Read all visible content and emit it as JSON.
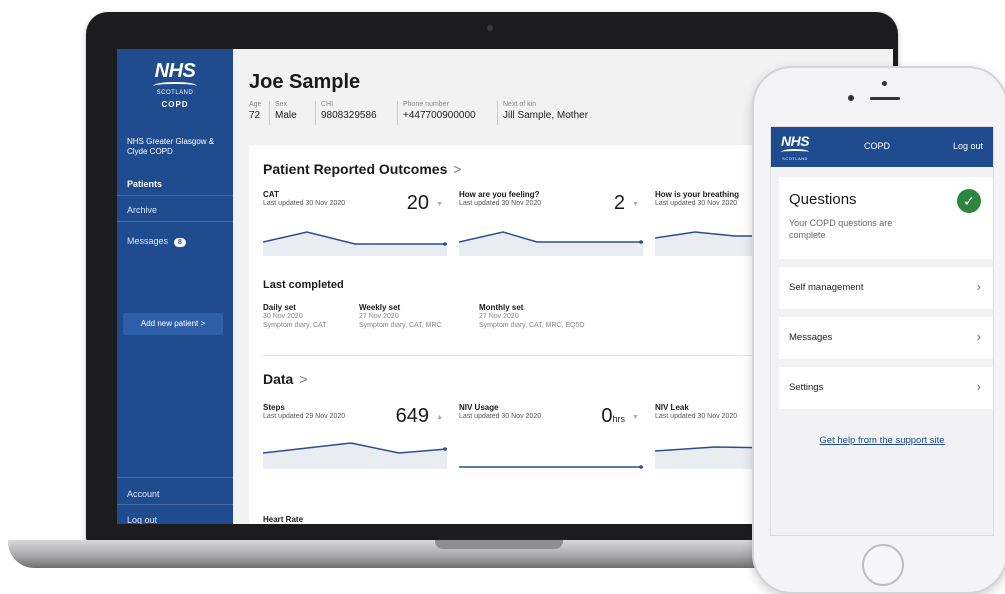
{
  "sidebar": {
    "logo": {
      "nhs": "NHS",
      "scotland": "SCOTLAND",
      "app": "COPD"
    },
    "org": "NHS Greater Glasgow & Clyde COPD",
    "nav": [
      {
        "label": "Patients"
      },
      {
        "label": "Archive"
      },
      {
        "label": "Messages",
        "badge": "8"
      }
    ],
    "add_patient": "Add new patient  >",
    "account": "Account",
    "logout": "Log out"
  },
  "patient": {
    "name": "Joe Sample",
    "fields": [
      {
        "label": "Age",
        "value": "72"
      },
      {
        "label": "Sex",
        "value": "Male"
      },
      {
        "label": "CHI",
        "value": "9808329586"
      },
      {
        "label": "Phone number",
        "value": "+447700900000"
      },
      {
        "label": "Next of kin",
        "value": "Jill Sample, Mother"
      }
    ]
  },
  "pro": {
    "title": "Patient Reported Outcomes",
    "metrics": [
      {
        "title": "CAT",
        "sub": "Last updated 30 Nov 2020",
        "value": "20",
        "arrow": "▼"
      },
      {
        "title": "How are you feeling?",
        "sub": "Last updated 30 Nov 2020",
        "value": "2",
        "arrow": "▼"
      },
      {
        "title": "How is your breathing",
        "sub": "Last updated 30 Nov 2020",
        "value": "",
        "arrow": ""
      }
    ]
  },
  "last_completed": {
    "title": "Last completed",
    "sets": [
      {
        "title": "Daily set",
        "date": "30 Nov 2020",
        "items": "Symptom diary, CAT"
      },
      {
        "title": "Weekly set",
        "date": "27 Nov 2020",
        "items": "Symptom diary, CAT, MRC"
      },
      {
        "title": "Monthly set",
        "date": "27 Nov 2020",
        "items": "Symptom diary, CAT, MRC, EQ5D"
      }
    ]
  },
  "data_section": {
    "title": "Data",
    "metrics": [
      {
        "title": "Steps",
        "sub": "Last updated 29 Nov 2020",
        "value": "649",
        "unit": "",
        "arrow": "▲"
      },
      {
        "title": "NIV Usage",
        "sub": "Last updated 30 Nov 2020",
        "value": "0",
        "unit": "hrs",
        "arrow": "▼"
      },
      {
        "title": "NIV Leak",
        "sub": "Last updated 30 Nov 2020",
        "value": "",
        "unit": "",
        "arrow": ""
      }
    ],
    "next_title": "Heart Rate"
  },
  "phone": {
    "logo": {
      "nhs": "NHS",
      "scotland": "SCOTLAND"
    },
    "header_title": "COPD",
    "logout": "Log out",
    "questions_title": "Questions",
    "questions_sub": "Your COPD questions are complete",
    "rows": [
      {
        "label": "Self management"
      },
      {
        "label": "Messages"
      },
      {
        "label": "Settings"
      }
    ],
    "help_link": "Get help from the support site"
  },
  "colors": {
    "brand": "#1f4b8f",
    "success": "#2e8540"
  }
}
